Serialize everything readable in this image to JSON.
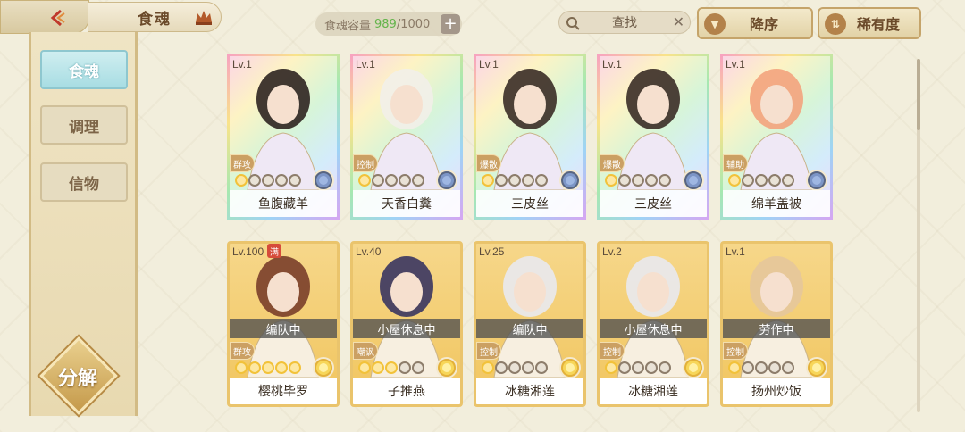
{
  "header": {
    "title": "食魂",
    "capacity_label": "食魂容量",
    "capacity_current": "989",
    "capacity_max": "/1000",
    "capacity_add": "+",
    "search_label": "查找",
    "search_clear": "✕",
    "sort_order_label": "降序",
    "sort_order_icon": "▼",
    "sort_key_label": "稀有度",
    "sort_key_icon": "⇅"
  },
  "sidebar": {
    "items": [
      {
        "label": "食魂"
      },
      {
        "label": "调理"
      },
      {
        "label": "信物"
      }
    ],
    "decompose_label": "分解"
  },
  "cards": [
    {
      "level": "Lv.1",
      "name": "鱼腹藏羊",
      "role": "群攻",
      "status": "",
      "stars_on": 1,
      "element": "blue"
    },
    {
      "level": "Lv.1",
      "name": "天香白糞",
      "role": "控制",
      "status": "",
      "stars_on": 1,
      "element": "blue"
    },
    {
      "level": "Lv.1",
      "name": "三皮丝",
      "role": "爆散",
      "status": "",
      "stars_on": 1,
      "element": "blue"
    },
    {
      "level": "Lv.1",
      "name": "三皮丝",
      "role": "爆散",
      "status": "",
      "stars_on": 1,
      "element": "blue"
    },
    {
      "level": "Lv.1",
      "name": "绵羊盖被",
      "role": "辅助",
      "status": "",
      "stars_on": 1,
      "element": "blue"
    },
    {
      "level": "Lv.100",
      "name": "樱桃毕罗",
      "role": "群攻",
      "status": "编队中",
      "stars_on": 5,
      "element": "yellow",
      "badge": "满"
    },
    {
      "level": "Lv.40",
      "name": "子推燕",
      "role": "嘲讽",
      "status": "小屋休息中",
      "stars_on": 3,
      "element": "yellow"
    },
    {
      "level": "Lv.25",
      "name": "冰糖湘莲",
      "role": "控制",
      "status": "编队中",
      "stars_on": 1,
      "element": "yellow"
    },
    {
      "level": "Lv.2",
      "name": "冰糖湘莲",
      "role": "控制",
      "status": "小屋休息中",
      "stars_on": 1,
      "element": "yellow"
    },
    {
      "level": "Lv.1",
      "name": "扬州炒饭",
      "role": "控制",
      "status": "劳作中",
      "stars_on": 1,
      "element": "yellow"
    }
  ],
  "colors": {
    "background": "#f2eedc",
    "active_tab": "#a8dde3",
    "capacity_green": "#63b44a",
    "rainbow_frame": "#f9e38a",
    "gold_frame": "#eac46c"
  },
  "icons": [
    "back-chevron-icon",
    "crown-icon",
    "search-icon",
    "sort-down-icon",
    "sort-swap-icon",
    "element-flower-icon"
  ]
}
